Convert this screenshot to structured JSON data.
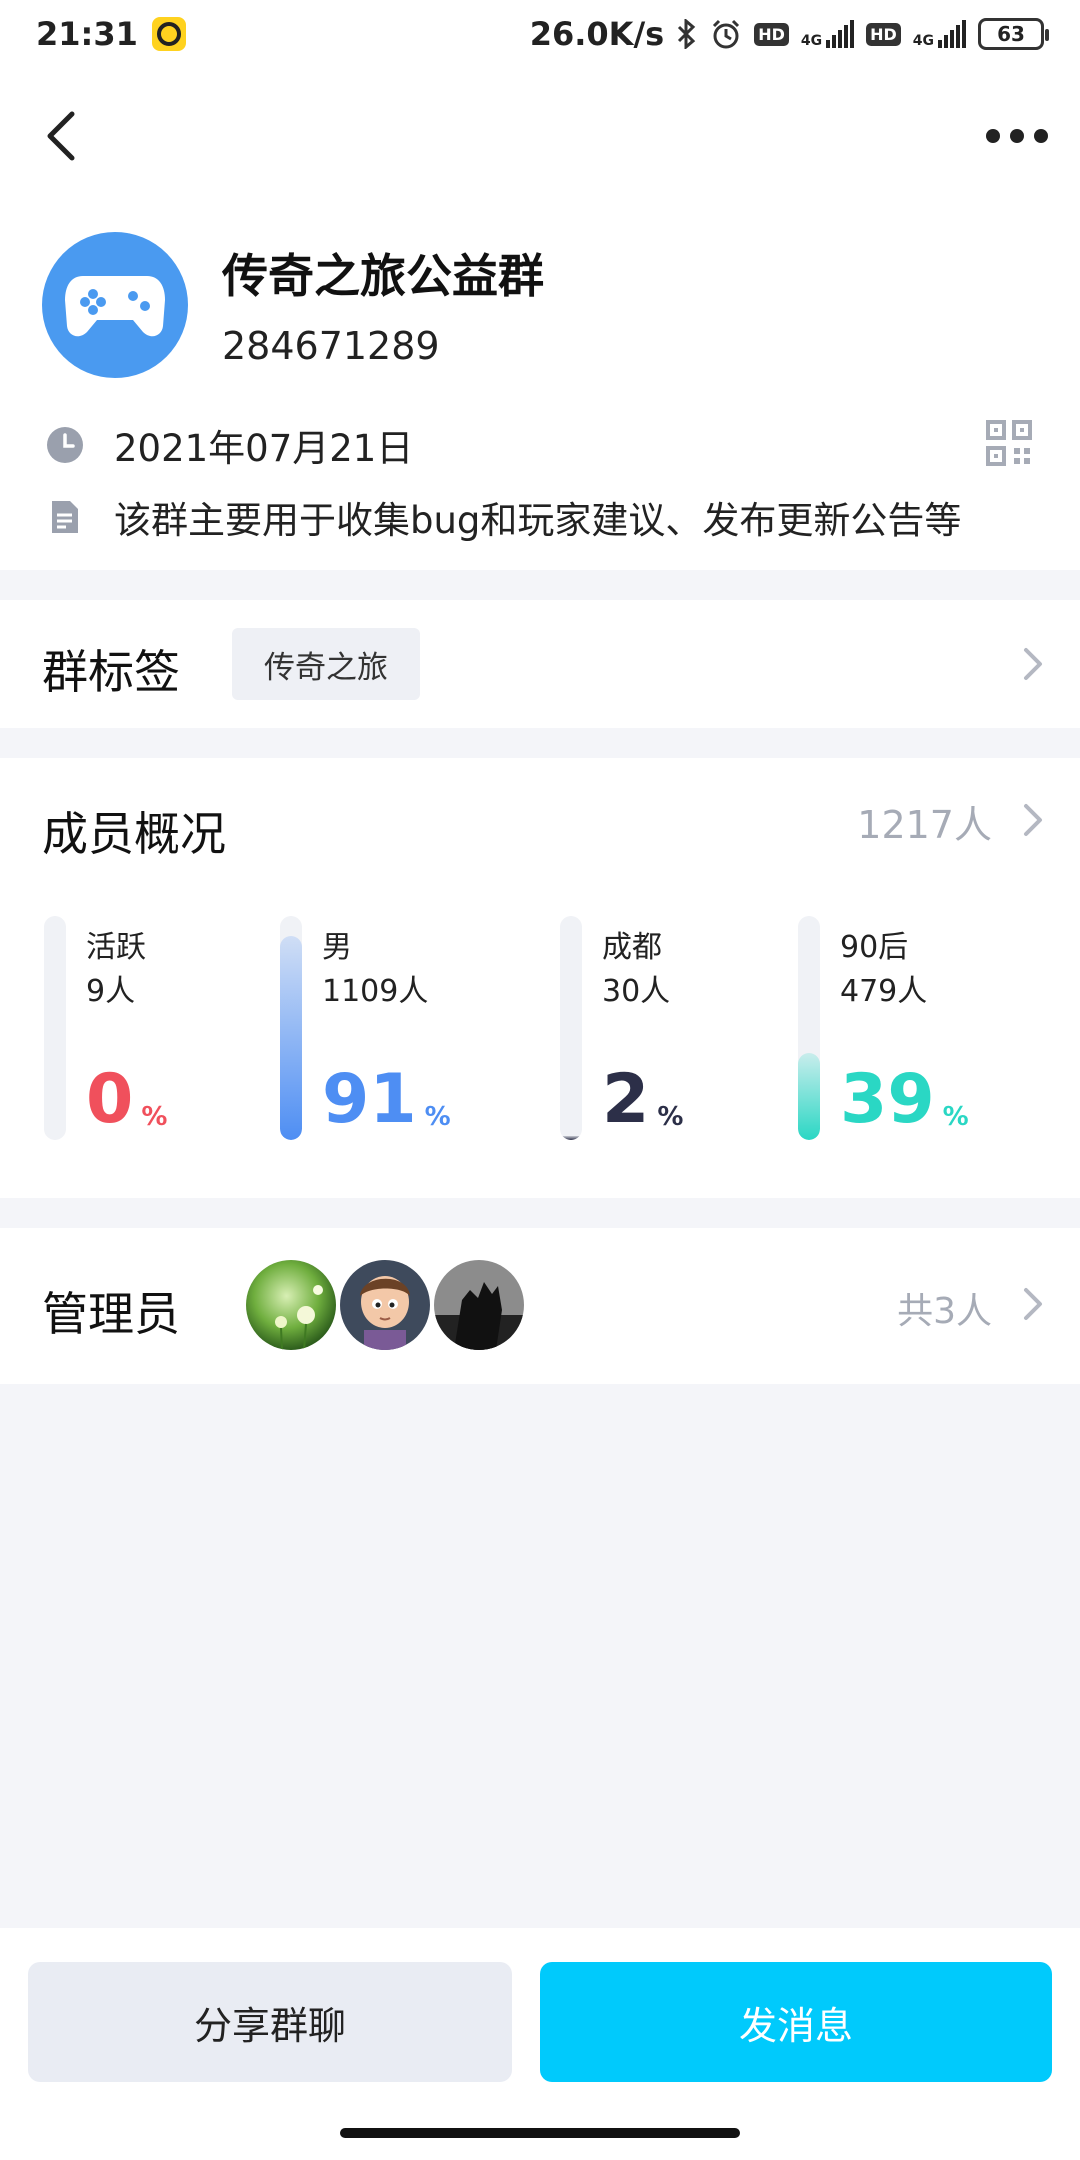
{
  "status_bar": {
    "time": "21:31",
    "net_speed": "26.0K/s",
    "hd_label": "HD",
    "signal_label": "4G",
    "battery": "63"
  },
  "header": {
    "back_icon": "back-arrow-icon",
    "more_icon": "more-dots-icon"
  },
  "group": {
    "avatar_icon": "gamepad-icon",
    "avatar_color": "#4A9AF0",
    "name": "传奇之旅公益群",
    "id": "284671289",
    "created_date": "2021年07月21日",
    "description": "该群主要用于收集bug和玩家建议、发布更新公告等"
  },
  "tags": {
    "title": "群标签",
    "items": [
      "传奇之旅"
    ]
  },
  "members": {
    "title": "成员概况",
    "count": "1217人",
    "stats": [
      {
        "label": "活跃",
        "count": "9人",
        "percent": "0",
        "unit": "%",
        "fraction": 0.0,
        "color": "#F0505C"
      },
      {
        "label": "男",
        "count": "1109人",
        "percent": "91",
        "unit": "%",
        "fraction": 0.91,
        "color": "#4E8EF3"
      },
      {
        "label": "成都",
        "count": "30人",
        "percent": "2",
        "unit": "%",
        "fraction": 0.02,
        "color": "#2C2F48"
      },
      {
        "label": "90后",
        "count": "479人",
        "percent": "39",
        "unit": "%",
        "fraction": 0.39,
        "color": "#2AD7C4"
      }
    ]
  },
  "admins": {
    "title": "管理员",
    "total": "共3人",
    "avatars": [
      "dandelion-photo",
      "cartoon-boy-photo",
      "silhouette-photo"
    ]
  },
  "actions": {
    "share_label": "分享群聊",
    "send_label": "发消息",
    "send_color": "#00CAFC"
  }
}
